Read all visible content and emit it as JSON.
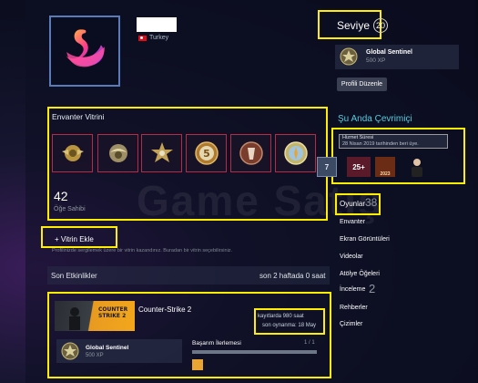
{
  "profile": {
    "country": "Turkey",
    "level_label": "Seviye",
    "level_value": "20",
    "badge": {
      "title": "Global Sentinel",
      "xp": "500 XP"
    },
    "edit_button": "Profili Düzenle"
  },
  "showcase": {
    "title": "Envanter Vitrini",
    "count": "42",
    "count_label": "Öğe Sahibi",
    "items": [
      {
        "icon": "wing-medal-icon"
      },
      {
        "icon": "eagle-medal-icon"
      },
      {
        "icon": "star-medal-icon"
      },
      {
        "icon": "five-year-coin-icon"
      },
      {
        "icon": "service-medal-icon"
      },
      {
        "icon": "globe-coin-icon"
      }
    ],
    "add_button": "+ Vitrin Ekle",
    "hint": "Profilinizde sergilemek üzere bir vitrin kazandınız. Buradan bir vitrin seçebilirsiniz."
  },
  "watermark": "Game Satış",
  "activity": {
    "title": "Son Etkinlikler",
    "hours": "son 2 haftada 0 saat",
    "game": {
      "name": "Counter-Strike 2",
      "thumb_text": "COUNTER STRIKE 2",
      "playtime_total": "kayıtlarda 980 saat",
      "playtime_last": "son oynanma: 18 May",
      "badge_title": "Global Sentinel",
      "badge_xp": "500 XP",
      "achievement_label": "Başarım İlerlemesi",
      "achievement_count": "1 / 1",
      "achievement_progress": 1.0
    }
  },
  "sidebar": {
    "online_title": "Şu Anda Çevrimiçi",
    "service_title": "Hizmet Süresi",
    "service_since": "28 Nisan 2019 tarihinden beri üye.",
    "mini_badges": [
      "7",
      "25+",
      "2023",
      ""
    ],
    "games_label": "Oyunlar",
    "games_count": "38",
    "links": [
      "Envanter",
      "Ekran Görüntüleri",
      "Videolar",
      "Atölye Öğeleri",
      "İnceleme",
      "Rehberler",
      "Çizimler"
    ],
    "reviews_count": "2"
  },
  "colors": {
    "highlight": "#ffee00",
    "accent": "#57cbde",
    "slot_border": "#b72b44"
  }
}
